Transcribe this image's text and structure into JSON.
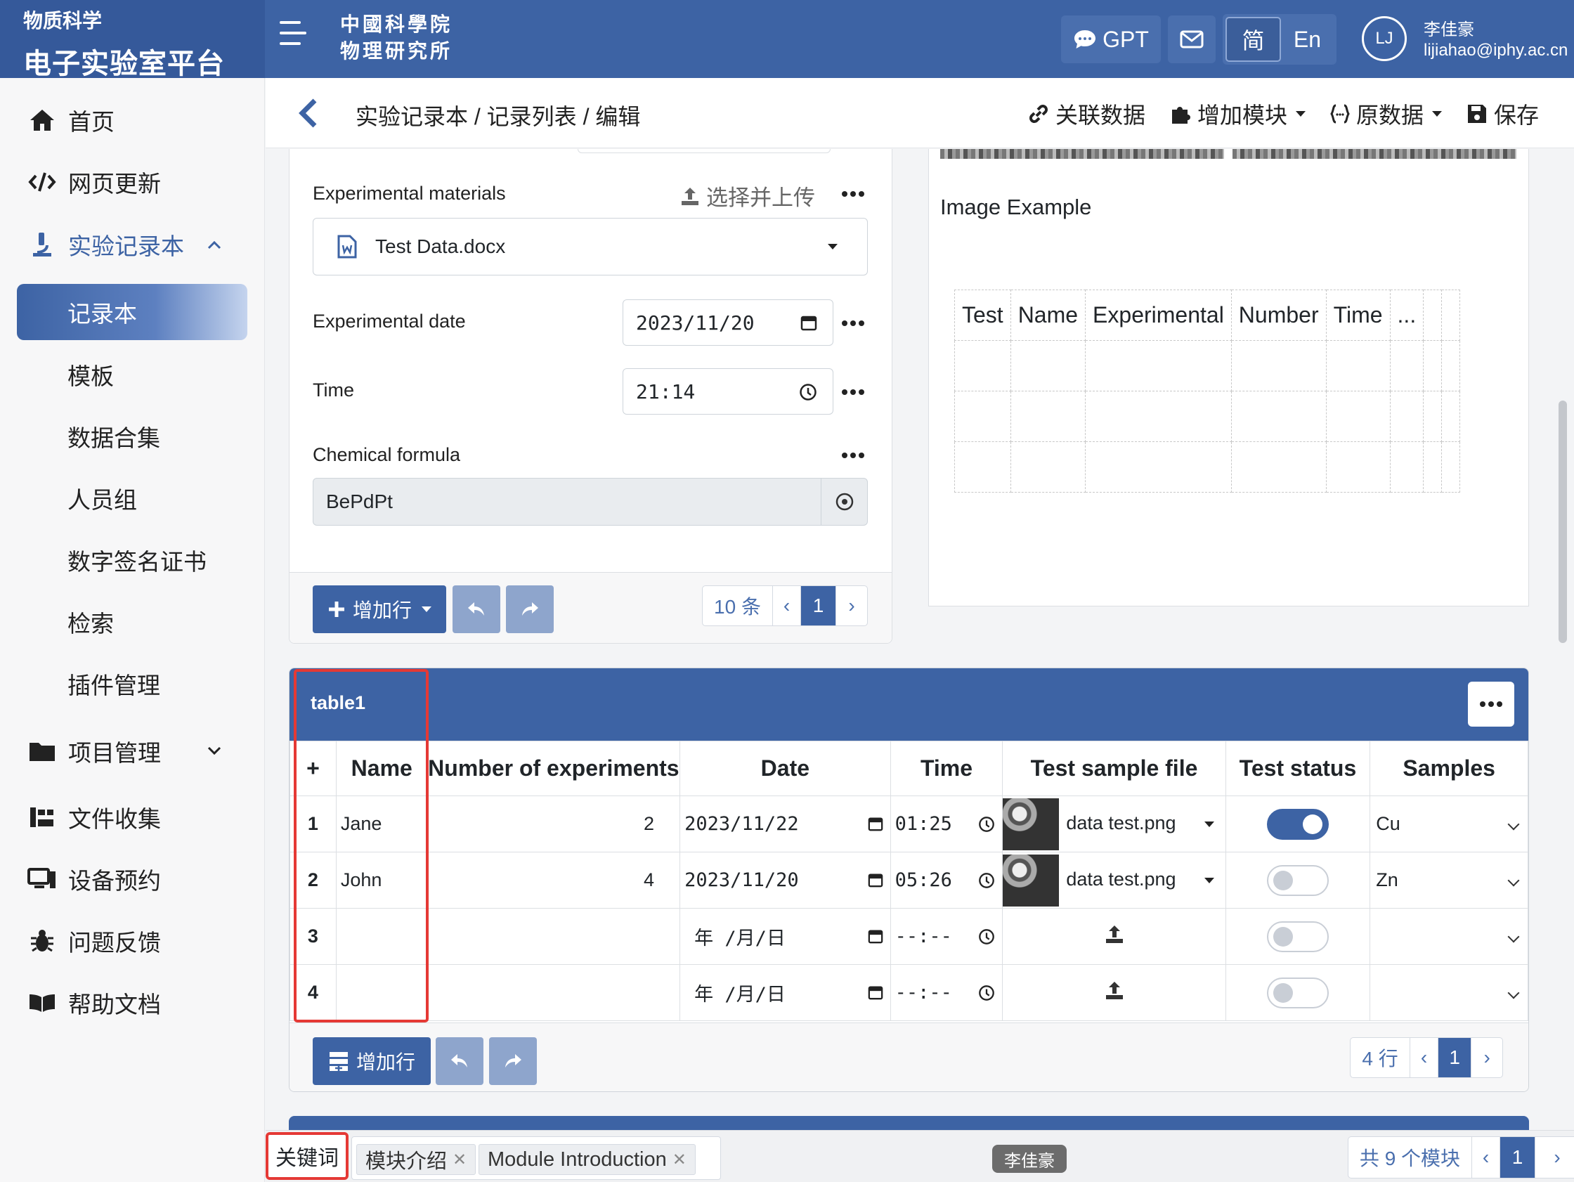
{
  "header": {
    "brand_sub": "物质科学",
    "brand_main": "电子实验室平台",
    "institute_line1": "中國科學院",
    "institute_line2": "物理研究所",
    "gpt_label": "GPT",
    "lang_zh": "简",
    "lang_en": "En",
    "avatar_initials": "LJ",
    "user_name": "李佳豪",
    "user_email": "lijiahao@iphy.ac.cn"
  },
  "sidebar": {
    "items": [
      {
        "label": "首页",
        "icon": "home-icon"
      },
      {
        "label": "网页更新",
        "icon": "code-icon"
      },
      {
        "label": "实验记录本",
        "icon": "microscope-icon"
      },
      {
        "label": "项目管理",
        "icon": "folder-icon"
      },
      {
        "label": "文件收集",
        "icon": "file-collect-icon"
      },
      {
        "label": "设备预约",
        "icon": "device-icon"
      },
      {
        "label": "问题反馈",
        "icon": "bug-icon"
      },
      {
        "label": "帮助文档",
        "icon": "book-icon"
      }
    ],
    "subitems": [
      "记录本",
      "模板",
      "数据合集",
      "人员组",
      "数字签名证书",
      "检索",
      "插件管理"
    ]
  },
  "breadcrumb": {
    "path": "实验记录本 / 记录列表 / 编辑",
    "link_data": "关联数据",
    "add_module": "增加模块",
    "raw_data": "原数据",
    "save": "保存"
  },
  "form": {
    "materials_label": "Experimental materials",
    "upload_label": "选择并上传",
    "materials_file": "Test Data.docx",
    "date_label": "Experimental date",
    "date_value": "2023/11/20",
    "time_label": "Time",
    "time_value": "21:14",
    "formula_label": "Chemical formula",
    "formula_value": "BePdPt",
    "add_row": "增加行",
    "page_size": "10 条",
    "page_current": "1"
  },
  "image_example": {
    "title": "Image Example",
    "columns": [
      "Test",
      "Name",
      "Experimental",
      "Number",
      "Time",
      "..."
    ]
  },
  "table1": {
    "title": "table1",
    "add_symbol": "+",
    "columns": [
      "Name",
      "Number of experiments",
      "Date",
      "Time",
      "Test sample file",
      "Test status",
      "Samples"
    ],
    "rows": [
      {
        "idx": "1",
        "name": "Jane",
        "num": "2",
        "date": "2023/11/22",
        "time": "01:25",
        "file": "data test.png",
        "status_on": true,
        "sample": "Cu"
      },
      {
        "idx": "2",
        "name": "John",
        "num": "4",
        "date": "2023/11/20",
        "time": "05:26",
        "file": "data test.png",
        "status_on": false,
        "sample": "Zn"
      },
      {
        "idx": "3",
        "name": "",
        "num": "",
        "date": "年 /月/日",
        "time": "--:--",
        "file": "",
        "status_on": false,
        "sample": ""
      },
      {
        "idx": "4",
        "name": "",
        "num": "",
        "date": "年 /月/日",
        "time": "--:--",
        "file": "",
        "status_on": false,
        "sample": ""
      }
    ],
    "add_row": "增加行",
    "row_count": "4 行",
    "page_current": "1"
  },
  "bottom": {
    "keyword_label": "关键词",
    "tags": [
      "模块介绍",
      "Module Introduction"
    ],
    "owner": "李佳豪",
    "module_count": "共 9 个模块",
    "page_current": "1"
  },
  "colors": {
    "primary": "#3d63a4",
    "highlight": "#e53935"
  }
}
